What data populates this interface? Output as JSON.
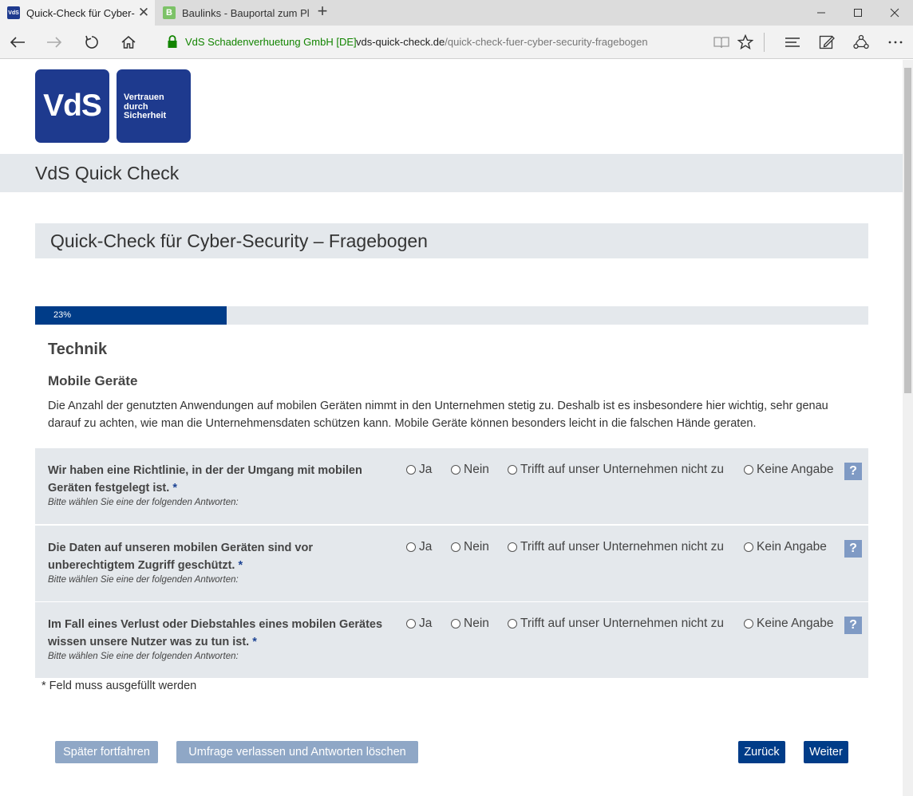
{
  "browser": {
    "tabs": [
      {
        "title": "Quick-Check für Cyber-",
        "favicon": "VdS"
      },
      {
        "title": "Baulinks - Bauportal zum Pl",
        "favicon": "B"
      }
    ],
    "site_identity": "VdS Schadenverhuetung GmbH [DE]",
    "url_domain": "vds-quick-check.de",
    "url_path": "/quick-check-fuer-cyber-security-fragebogen"
  },
  "logo": {
    "text": "VdS",
    "claim_line1": "Vertrauen",
    "claim_line2": "durch",
    "claim_line3": "Sicherheit"
  },
  "brand_title": "VdS Quick Check",
  "page_title": "Quick-Check für Cyber-Security – Fragebogen",
  "progress": {
    "value": 0.23,
    "label": "23%"
  },
  "section": {
    "title": "Technik",
    "subtitle": "Mobile Geräte",
    "intro": "Die Anzahl der genutzten Anwendungen auf mobilen Geräten nimmt in den Unternehmen stetig zu. Deshalb ist es insbesondere hier wichtig, sehr genau darauf zu achten, wie man die Unternehmensdaten schützen kann. Mobile Geräte können besonders leicht in die falschen Hände geraten."
  },
  "questions": [
    {
      "text": "Wir haben eine Richtlinie, in der der Umgang mit mobilen Geräten festgelegt ist.",
      "required_mark": "*",
      "hint": "Bitte wählen Sie eine der folgenden Antworten:",
      "options": [
        "Ja",
        "Nein",
        "Trifft auf unser Unternehmen nicht zu",
        "Keine Angabe"
      ],
      "help": "?"
    },
    {
      "text": "Die Daten auf unseren mobilen Geräten sind vor unberechtigtem Zugriff geschützt.",
      "required_mark": "*",
      "hint": "Bitte wählen Sie eine der folgenden Antworten:",
      "options": [
        "Ja",
        "Nein",
        "Trifft auf unser Unternehmen nicht zu",
        "Kein Angabe"
      ],
      "help": "?"
    },
    {
      "text": "Im Fall eines Verlust oder Diebstahles eines mobilen Gerätes wissen unsere Nutzer was zu tun ist.",
      "required_mark": "*",
      "hint": "Bitte wählen Sie eine der folgenden Antworten:",
      "options": [
        "Ja",
        "Nein",
        "Trifft auf unser Unternehmen nicht zu",
        "Keine Angabe"
      ],
      "help": "?"
    }
  ],
  "required_note": "* Feld muss ausgefüllt werden",
  "buttons": {
    "later": "Später fortfahren",
    "leave": "Umfrage verlassen und Antworten löschen",
    "back": "Zurück",
    "next": "Weiter"
  },
  "colors": {
    "brand_blue": "#1e3a8e",
    "primary_button": "#003c88",
    "secondary_button": "#8fa7c6",
    "panel_gray": "#e4e8ec",
    "secure_green": "#128400"
  }
}
